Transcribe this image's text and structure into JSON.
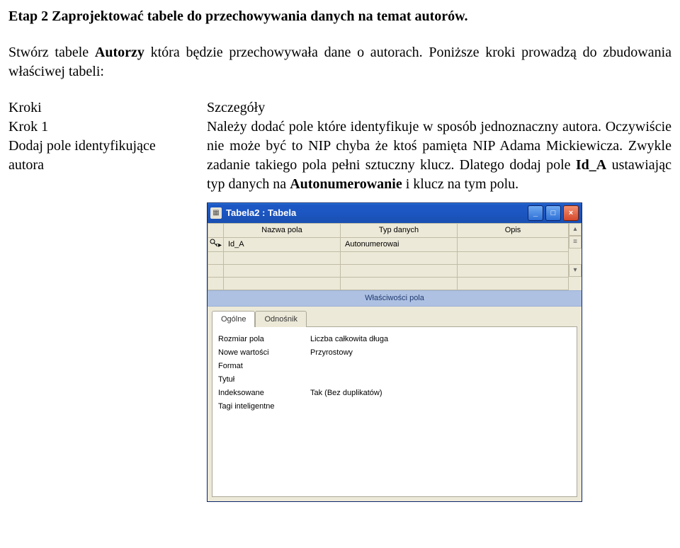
{
  "doc": {
    "heading": "Etap 2 Zaprojektować tabele do przechowywania danych na temat autorów.",
    "intro_pre": "Stwórz tabele ",
    "intro_bold": "Autorzy",
    "intro_post": " która będzie przechowywała dane o autorach. Poniższe kroki prowadzą do zbudowania właściwej tabeli:",
    "left_hdr": "Kroki",
    "right_hdr": "Szczegóły",
    "left_body1": "Krok 1",
    "left_body2": "Dodaj pole identyfikujące autora",
    "right_body1": "Należy dodać pole które identyfikuje w sposób jednoznaczny autora. Oczywiście nie może być to NIP chyba że ktoś pamięta NIP Adama Mickiewicza. Zwykle zadanie takiego pola pełni sztuczny klucz. Dlatego dodaj pole ",
    "right_body_bold1": "Id_A",
    "right_body2": " ustawiając typ danych na ",
    "right_body_bold2": "Autonumerowanie",
    "right_body3": " i klucz na tym polu."
  },
  "window": {
    "title": "Tabela2 : Tabela",
    "icon_glyph": "▦",
    "min": "_",
    "max": "□",
    "close": "×",
    "grid": {
      "headers": {
        "rowhdr": "",
        "name": "Nazwa pola",
        "type": "Typ danych",
        "desc": "Opis"
      },
      "rows": [
        {
          "key": true,
          "arrow": "▸",
          "name": "Id_A",
          "type": "Autonumerowai",
          "desc": ""
        },
        {
          "key": false,
          "arrow": "",
          "name": "",
          "type": "",
          "desc": ""
        },
        {
          "key": false,
          "arrow": "",
          "name": "",
          "type": "",
          "desc": ""
        },
        {
          "key": false,
          "arrow": "",
          "name": "",
          "type": "",
          "desc": ""
        }
      ],
      "scroll_up": "▴",
      "scroll_thumb": "≡",
      "scroll_down": "▾"
    },
    "propbar": "Właściwości pola",
    "tabs": {
      "general": "Ogólne",
      "lookup": "Odnośnik"
    },
    "props": {
      "left": [
        {
          "label": "Rozmiar pola",
          "value": "Liczba całkowita długa"
        },
        {
          "label": "Nowe wartości",
          "value": "Przyrostowy"
        },
        {
          "label": "Format",
          "value": ""
        },
        {
          "label": "Tytuł",
          "value": ""
        },
        {
          "label": "Indeksowane",
          "value": "Tak (Bez duplikatów)"
        },
        {
          "label": "Tagi inteligentne",
          "value": ""
        }
      ]
    }
  }
}
